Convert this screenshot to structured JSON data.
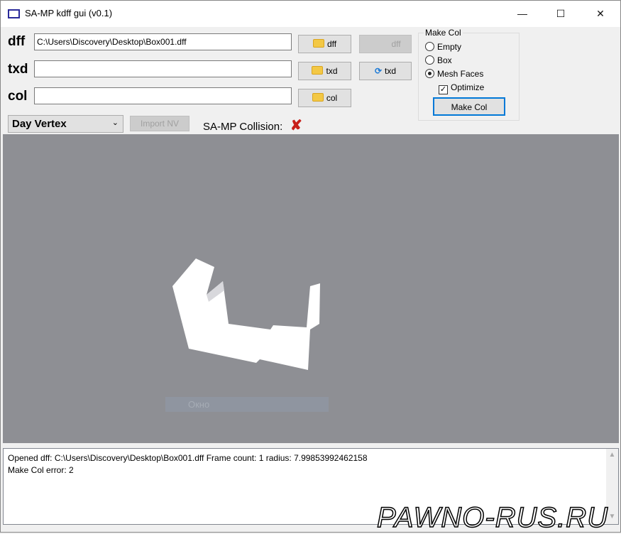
{
  "window": {
    "title": "SA-MP kdff gui (v0.1)",
    "minimize": "—",
    "maximize": "☐",
    "close": "✕"
  },
  "files": {
    "dff": {
      "label": "dff",
      "value": "C:\\Users\\Discovery\\Desktop\\Box001.dff",
      "browse": "dff",
      "action": "dff"
    },
    "txd": {
      "label": "txd",
      "value": "",
      "browse": "txd",
      "action": "txd"
    },
    "col": {
      "label": "col",
      "value": "",
      "browse": "col"
    }
  },
  "vertex_select": {
    "selected": "Day Vertex"
  },
  "import_nv": "Import NV",
  "collision": {
    "label": "SA-MP Collision:",
    "status_icon": "red-x-icon"
  },
  "make_col": {
    "title": "Make Col",
    "options": [
      "Empty",
      "Box",
      "Mesh Faces"
    ],
    "selected": "Mesh Faces",
    "optimize_label": "Optimize",
    "optimize_checked": true,
    "button": "Make Col"
  },
  "viewport": {
    "overlay_label": "Окно"
  },
  "log": {
    "lines": [
      "Opened dff: C:\\Users\\Discovery\\Desktop\\Box001.dff Frame count: 1 radius: 7.99853992462158",
      "Make Col error: 2"
    ]
  },
  "watermark": "PAWNO-RUS.RU"
}
